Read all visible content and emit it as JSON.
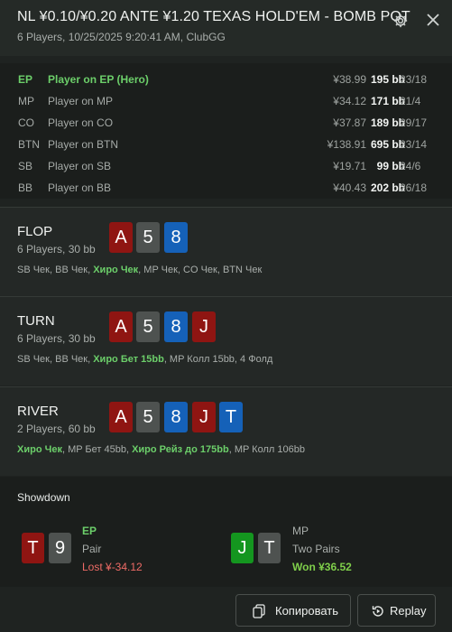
{
  "header": {
    "title": "NL ¥0.10/¥0.20 ANTE ¥1.20 TEXAS HOLD'EM - BOMB POT",
    "subtitle": "6 Players, 10/25/2025 9:20:41 AM, ClubGG",
    "settings_icon": "gear-icon",
    "close_icon": "close-icon"
  },
  "players": [
    {
      "pos": "EP",
      "name": "Player on EP (Hero)",
      "money": "¥38.99",
      "bb": "195 bb",
      "hands": "23/18",
      "hero": true
    },
    {
      "pos": "MP",
      "name": "Player on MP",
      "money": "¥34.12",
      "bb": "171 bb",
      "hands": "21/4"
    },
    {
      "pos": "CO",
      "name": "Player on CO",
      "money": "¥37.87",
      "bb": "189 bb",
      "hands": "29/17"
    },
    {
      "pos": "BTN",
      "name": "Player on BTN",
      "money": "¥138.91",
      "bb": "695 bb",
      "hands": "23/14"
    },
    {
      "pos": "SB",
      "name": "Player on SB",
      "money": "¥19.71",
      "bb": "99 bb",
      "hands": "24/6"
    },
    {
      "pos": "BB",
      "name": "Player on BB",
      "money": "¥40.43",
      "bb": "202 bb",
      "hands": "26/18"
    }
  ],
  "streets": [
    {
      "name": "FLOP",
      "info": "6 Players, 30 bb",
      "cards": [
        {
          "rank": "A",
          "color": "red"
        },
        {
          "rank": "5",
          "color": "gray"
        },
        {
          "rank": "8",
          "color": "blue"
        }
      ],
      "actions": [
        {
          "text": "SB Чек, BB Чек, ",
          "hero": false
        },
        {
          "text": "Хиро Чек",
          "hero": true
        },
        {
          "text": ", MP Чек, CO Чек, BTN Чек",
          "hero": false
        }
      ]
    },
    {
      "name": "TURN",
      "info": "6 Players, 30 bb",
      "cards": [
        {
          "rank": "A",
          "color": "red"
        },
        {
          "rank": "5",
          "color": "gray"
        },
        {
          "rank": "8",
          "color": "blue"
        },
        {
          "rank": "J",
          "color": "red"
        }
      ],
      "actions": [
        {
          "text": "SB Чек, BB Чек, ",
          "hero": false
        },
        {
          "text": "Хиро Бет 15bb",
          "hero": true
        },
        {
          "text": ", MP Колл 15bb, 4 Фолд",
          "hero": false
        }
      ]
    },
    {
      "name": "RIVER",
      "info": "2 Players, 60 bb",
      "cards": [
        {
          "rank": "A",
          "color": "red"
        },
        {
          "rank": "5",
          "color": "gray"
        },
        {
          "rank": "8",
          "color": "blue"
        },
        {
          "rank": "J",
          "color": "red"
        },
        {
          "rank": "T",
          "color": "blue"
        }
      ],
      "actions": [
        {
          "text": "Хиро Чек",
          "hero": true
        },
        {
          "text": ", MP Бет 45bb, ",
          "hero": false
        },
        {
          "text": "Хиро Рейз до 175bb",
          "hero": true
        },
        {
          "text": ", MP Колл 106bb",
          "hero": false
        }
      ]
    }
  ],
  "showdown": {
    "title": "Showdown",
    "hands": [
      {
        "pos": "EP",
        "hand": "Pair",
        "result": "Lost ¥-34.12",
        "won": false,
        "cards": [
          {
            "rank": "T",
            "color": "red"
          },
          {
            "rank": "9",
            "color": "gray"
          }
        ]
      },
      {
        "pos": "MP",
        "hand": "Two Pairs",
        "result": "Won ¥36.52",
        "won": true,
        "cards": [
          {
            "rank": "J",
            "color": "green"
          },
          {
            "rank": "T",
            "color": "gray"
          }
        ]
      }
    ]
  },
  "footer": {
    "copy_label": "Копировать",
    "copy_icon": "copy-icon",
    "replay_label": "Replay",
    "replay_icon": "replay-icon"
  },
  "colors": {
    "hero_green": "#6ccf6a",
    "lost_red": "#ee6b66",
    "won_green": "#7fcf4a",
    "card_red": "#8f1512",
    "card_gray": "#4e5250",
    "card_blue": "#1561b8",
    "card_green": "#14961f"
  }
}
